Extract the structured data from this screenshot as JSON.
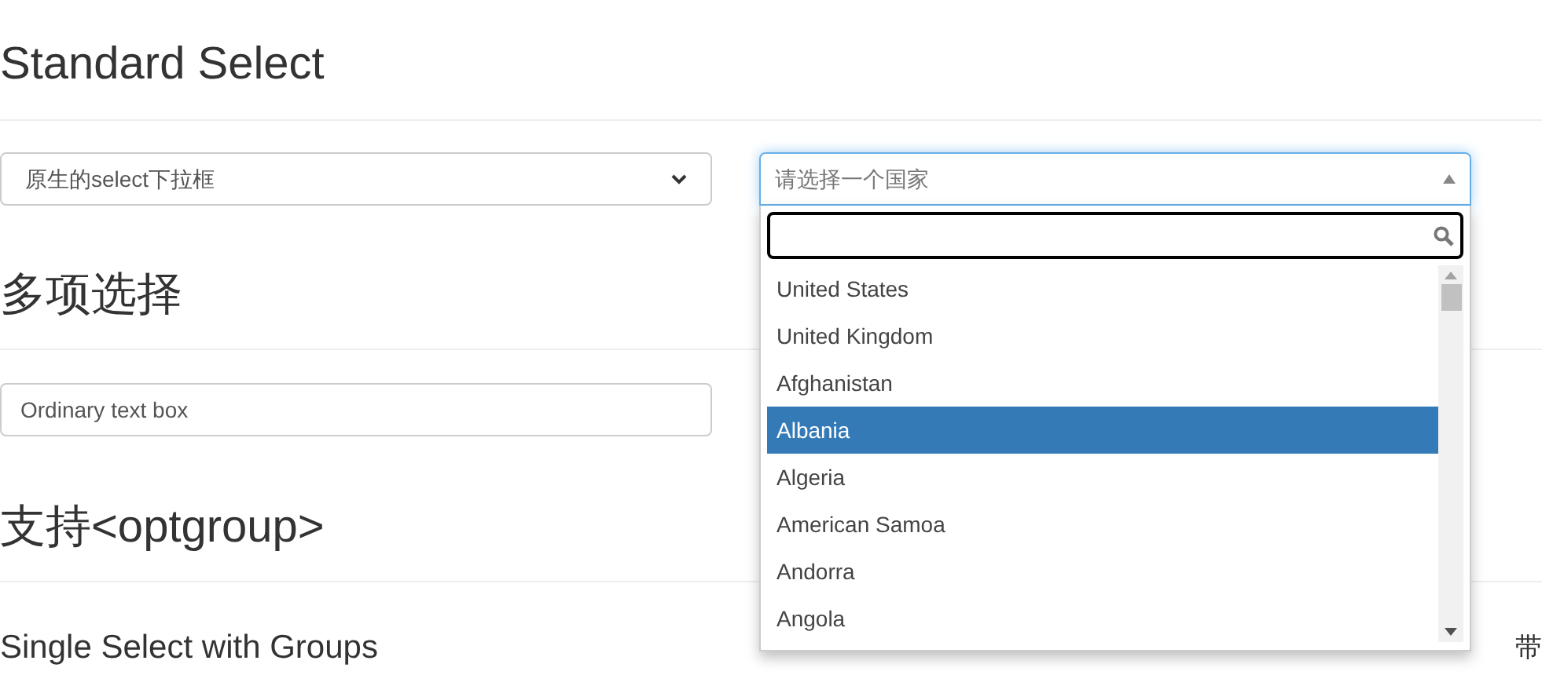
{
  "sections": [
    {
      "heading": "Standard Select"
    },
    {
      "heading": "多项选择"
    },
    {
      "heading": "支持<optgroup>"
    }
  ],
  "native_select": {
    "value": "原生的select下拉框"
  },
  "country_select": {
    "placeholder": "请选择一个国家",
    "expanded": true,
    "options": [
      {
        "label": "United States",
        "selected": false
      },
      {
        "label": "United Kingdom",
        "selected": false
      },
      {
        "label": "Afghanistan",
        "selected": false
      },
      {
        "label": "Albania",
        "selected": true
      },
      {
        "label": "Algeria",
        "selected": false
      },
      {
        "label": "American Samoa",
        "selected": false
      },
      {
        "label": "Andorra",
        "selected": false
      },
      {
        "label": "Angola",
        "selected": false
      }
    ]
  },
  "text_box": {
    "value": "Ordinary text box"
  },
  "subheading": "Single Select with Groups",
  "right_subheading": "带"
}
